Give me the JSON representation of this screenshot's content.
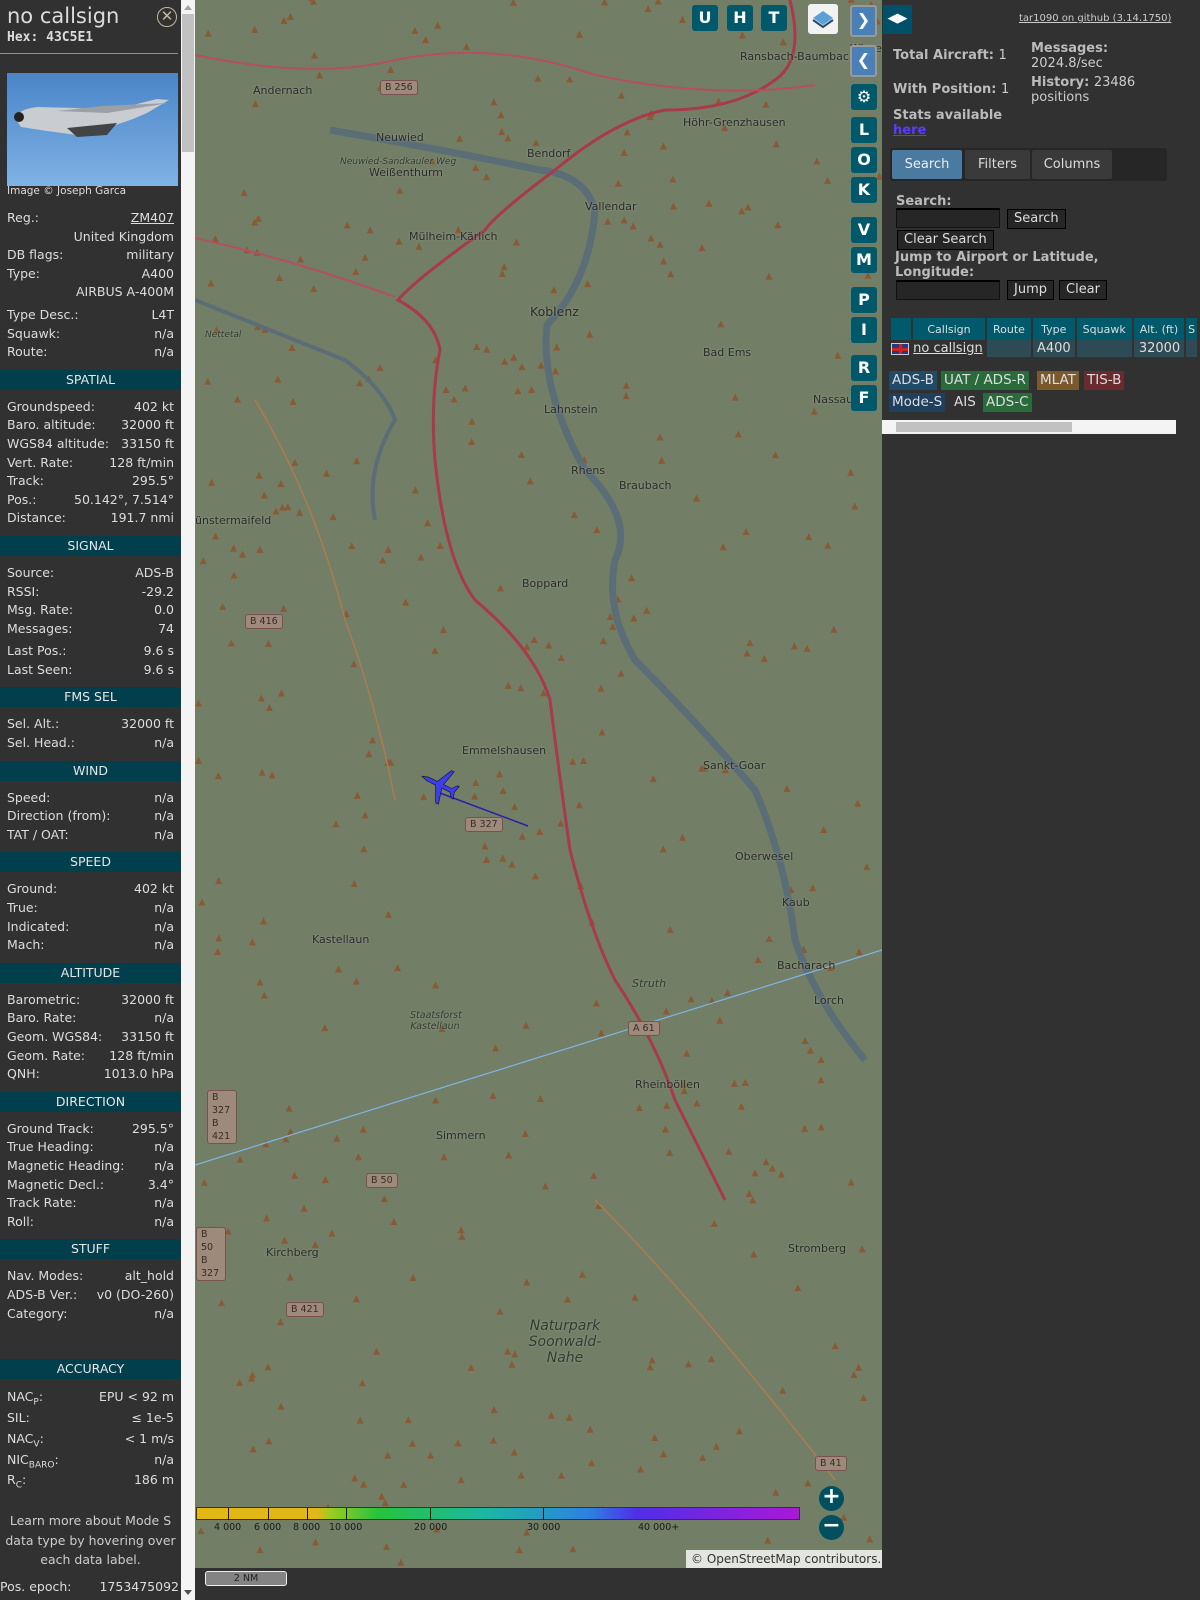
{
  "detail": {
    "callsign": "no callsign",
    "hex_label": "Hex:",
    "hex": "43C5E1",
    "close_icon": "circle-x-icon",
    "image_credit": "Image © Joseph Garca",
    "top_rows": [
      {
        "label": "Reg.:",
        "value": "ZM407",
        "link": true
      },
      {
        "label": "",
        "value": "United Kingdom"
      },
      {
        "label": "DB flags:",
        "value": "military"
      },
      {
        "label": "Type:",
        "value": "A400"
      },
      {
        "label": "",
        "value": "AIRBUS A-400M"
      },
      {
        "label": "Type Desc.:",
        "value": "L4T"
      },
      {
        "label": "Squawk:",
        "value": "n/a"
      },
      {
        "label": "Route:",
        "value": "n/a"
      }
    ],
    "sections": [
      {
        "title": "SPATIAL",
        "rows": [
          [
            "Groundspeed:",
            "402 kt"
          ],
          [
            "Baro. altitude:",
            "32000 ft"
          ],
          [
            "WGS84 altitude:",
            "33150 ft"
          ],
          [
            "Vert. Rate:",
            "128 ft/min"
          ],
          [
            "Track:",
            "295.5°"
          ],
          [
            "Pos.:",
            "50.142°, 7.514°"
          ],
          [
            "Distance:",
            "191.7 nmi"
          ]
        ]
      },
      {
        "title": "SIGNAL",
        "rows": [
          [
            "Source:",
            "ADS-B"
          ],
          [
            "RSSI:",
            "-29.2"
          ],
          [
            "Msg. Rate:",
            "0.0"
          ],
          [
            "Messages:",
            "74"
          ],
          [
            "Last Pos.:",
            "9.6 s"
          ],
          [
            "Last Seen:",
            "9.6 s"
          ]
        ]
      },
      {
        "title": "FMS SEL",
        "rows": [
          [
            "Sel. Alt.:",
            "32000 ft"
          ],
          [
            "Sel. Head.:",
            "n/a"
          ]
        ]
      },
      {
        "title": "WIND",
        "rows": [
          [
            "Speed:",
            "n/a"
          ],
          [
            "Direction (from):",
            "n/a"
          ],
          [
            "TAT / OAT:",
            "n/a"
          ]
        ]
      },
      {
        "title": "SPEED",
        "rows": [
          [
            "Ground:",
            "402 kt"
          ],
          [
            "True:",
            "n/a"
          ],
          [
            "Indicated:",
            "n/a"
          ],
          [
            "Mach:",
            "n/a"
          ]
        ]
      },
      {
        "title": "ALTITUDE",
        "rows": [
          [
            "Barometric:",
            "32000 ft"
          ],
          [
            "Baro. Rate:",
            "n/a"
          ],
          [
            "Geom. WGS84:",
            "33150 ft"
          ],
          [
            "Geom. Rate:",
            "128 ft/min"
          ],
          [
            "QNH:",
            "1013.0 hPa"
          ]
        ]
      },
      {
        "title": "DIRECTION",
        "rows": [
          [
            "Ground Track:",
            "295.5°"
          ],
          [
            "True Heading:",
            "n/a"
          ],
          [
            "Magnetic Heading:",
            "n/a"
          ],
          [
            "Magnetic Decl.:",
            "3.4°"
          ],
          [
            "Track Rate:",
            "n/a"
          ],
          [
            "Roll:",
            "n/a"
          ]
        ]
      },
      {
        "title": "STUFF",
        "rows": [
          [
            "Nav. Modes:",
            "alt_hold"
          ],
          [
            "ADS-B Ver.:",
            "v0 (DO-260)"
          ],
          [
            "Category:",
            "n/a"
          ]
        ]
      }
    ],
    "accuracy": {
      "title": "ACCURACY",
      "rows": [
        {
          "base": "NAC",
          "sub": "P",
          "value": "EPU < 92 m"
        },
        {
          "base": "SIL",
          "sub": "",
          "value": "≤ 1e-5"
        },
        {
          "base": "NAC",
          "sub": "V",
          "value": "< 1 m/s"
        },
        {
          "base": "NIC",
          "sub": "BARO",
          "value": "n/a"
        },
        {
          "base": "R",
          "sub": "C",
          "value": "186 m"
        }
      ]
    },
    "note": "Learn more about Mode S data type by hovering over each data label.",
    "epoch_label": "Pos. epoch:",
    "epoch": "1753475092"
  },
  "map": {
    "buttons_top": [
      "U",
      "H",
      "T"
    ],
    "buttons_side": [
      "L",
      "O",
      "K",
      "V",
      "M",
      "P",
      "I",
      "R",
      "F"
    ],
    "labels": [
      "Ransbach-Baumbach",
      "Andernach",
      "Höhr-Grenzhausen",
      "Neuwied",
      "Bendorf",
      "Neuwied-Sandkauler Weg",
      "Weißenthurm",
      "Vallendar",
      "Mülheim-Kärlich",
      "Koblenz",
      "Bad Ems",
      "Nassau",
      "Lahnstein",
      "Rhens",
      "Braubach",
      "ünstermaifeld",
      "Boppard",
      "Emmelshausen",
      "Sankt-Goar",
      "Oberwesel",
      "Kaub",
      "Kastellaun",
      "Bacharach",
      "Struth",
      "Staatsforst Kastellaun",
      "Lorch",
      "Rheinböllen",
      "Simmern",
      "Kirchberg",
      "Stromberg",
      "Naturpark Soonwald-Nahe",
      "Nettetal",
      "Wirge"
    ],
    "shields": [
      "B 256",
      "B 416",
      "B 327",
      "A 61",
      "B 327 B 421",
      "B 50",
      "B 50 B 327",
      "B 421",
      "B 41"
    ],
    "legend_ticks": [
      "4 000",
      "6 000",
      "8 000",
      "10 000",
      "20 000",
      "30 000",
      "40 000+"
    ],
    "scale": "2 NM",
    "attribution": "© OpenStreetMap contributors.",
    "aircraft_color": "#3c3cf0"
  },
  "panel": {
    "github": "tar1090 on github (3.14.1750)",
    "total_label": "Total Aircraft:",
    "total": "1",
    "withpos_label": "With Position:",
    "withpos": "1",
    "messages_label": "Messages:",
    "messages": "2024.8/sec",
    "history_label": "History:",
    "history": "23486 positions",
    "stats_label": "Stats available",
    "stats_link": "here",
    "tabs": [
      "Search",
      "Filters",
      "Columns"
    ],
    "search_label": "Search:",
    "search_value": "",
    "search_btn": "Search",
    "clear_search_btn": "Clear Search",
    "jump_label": "Jump to Airport or Latitude, Longitude:",
    "jump_value": "",
    "jump_btn": "Jump",
    "clear_btn": "Clear",
    "columns": [
      "",
      "Callsign",
      "Route",
      "Type",
      "Squawk",
      "Alt. (ft)",
      "S"
    ],
    "row": {
      "flag": "uk-flag-icon",
      "callsign": "no callsign",
      "route": "",
      "type": "A400",
      "squawk": "",
      "alt": "32000"
    },
    "badges": [
      {
        "t": "ADS-B",
        "c": "#1f4a68"
      },
      {
        "t": "UAT / ADS-R",
        "c": "#2a6b3c"
      },
      {
        "t": "MLAT",
        "c": "#7a5a2c"
      },
      {
        "t": "TIS-B",
        "c": "#6b2a2e"
      },
      {
        "t": "Mode-S",
        "c": "#1f3f5e"
      },
      {
        "t": "AIS",
        "c": "#313131"
      },
      {
        "t": "ADS-C",
        "c": "#2a6b3c"
      }
    ]
  }
}
